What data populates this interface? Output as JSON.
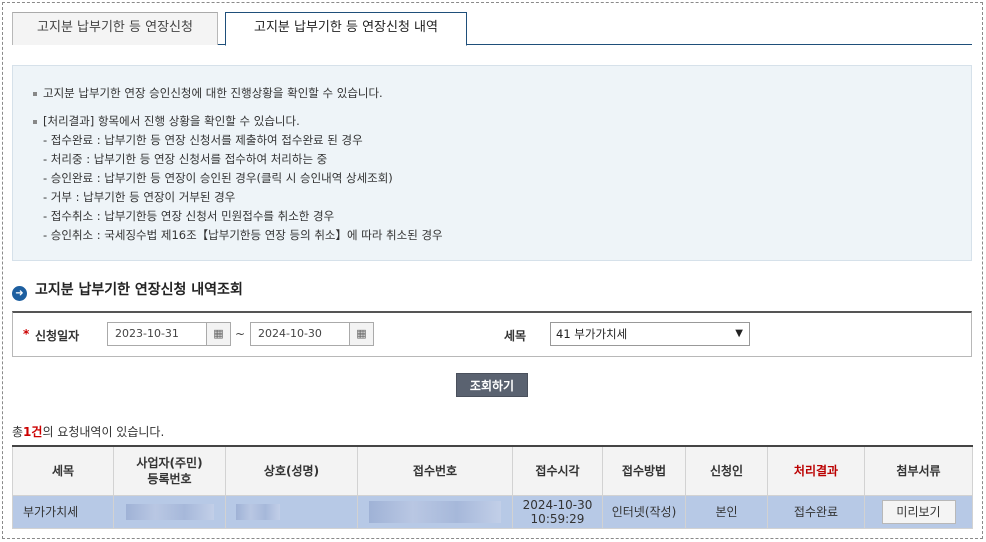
{
  "tabs": [
    {
      "label": "고지분 납부기한 등 연장신청"
    },
    {
      "label": "고지분 납부기한 등 연장신청 내역"
    }
  ],
  "info": {
    "line1": "고지분 납부기한 연장 승인신청에 대한 진행상황을 확인할 수 있습니다.",
    "line2": "[처리결과] 항목에서 진행 상황을 확인할 수 있습니다.",
    "statuses": [
      "- 접수완료 : 납부기한 등 연장 신청서를 제출하여 접수완료 된 경우",
      "- 처리중 : 납부기한 등 연장 신청서를 접수하여 처리하는 중",
      "- 승인완료 : 납부기한 등 연장이 승인된 경우(클릭 시 승인내역 상세조회)",
      "- 거부 : 납부기한 등 연장이 거부된 경우",
      "- 접수취소 : 납부기한등 연장 신청서 민원접수를 취소한 경우",
      "- 승인취소 : 국세징수법 제16조【납부기한등 연장 등의 취소】에 따라 취소된 경우"
    ]
  },
  "section_title": "고지분 납부기한 연장신청 내역조회",
  "search": {
    "required_mark": "*",
    "date_label": "신청일자",
    "date_from": "2023-10-31",
    "date_to": "2024-10-30",
    "tilde": "~",
    "tax_label": "세목",
    "tax_value": "41 부가가치세",
    "button": "조회하기"
  },
  "count": {
    "prefix": "총",
    "number": "1건",
    "suffix": "의 요청내역이 있습니다."
  },
  "table": {
    "headers": {
      "tax": "세목",
      "bizno_1": "사업자(주민)",
      "bizno_2": "등록번호",
      "name": "상호(성명)",
      "receipt_no": "접수번호",
      "receipt_time": "접수시각",
      "method": "접수방법",
      "applicant": "신청인",
      "result": "처리결과",
      "attach": "첨부서류"
    },
    "row": {
      "tax": "부가가치세",
      "date": "2024-10-30",
      "time": "10:59:29",
      "method": "인터넷(작성)",
      "applicant": "본인",
      "result": "접수완료",
      "preview": "미리보기"
    }
  },
  "icons": {
    "calendar": "calendar-icon",
    "section": "arrow-right-circle-icon"
  }
}
